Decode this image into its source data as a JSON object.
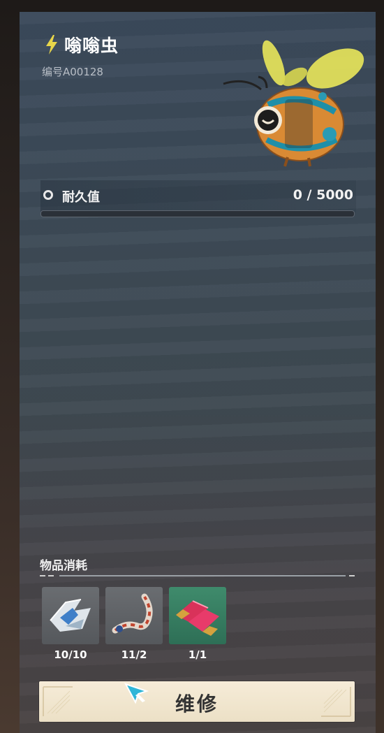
{
  "creature": {
    "name": "嗡嗡虫",
    "code": "编号A00128",
    "type_icon": "lightning-bolt-icon",
    "portrait_icon": "bee-robot-icon"
  },
  "durability": {
    "label": "耐久值",
    "value_text": "0 / 5000",
    "current": 0,
    "max": 5000,
    "fraction": 0
  },
  "consumables": {
    "title": "物品消耗",
    "items": [
      {
        "icon": "metal-shards-icon",
        "count": "10/10"
      },
      {
        "icon": "twisted-fiber-icon",
        "count": "11/2"
      },
      {
        "icon": "ruby-crystal-icon",
        "count": "1/1"
      }
    ]
  },
  "repair_button": {
    "label": "维修"
  },
  "colors": {
    "accent_yellow": "#e8d64a",
    "button_bg": "#f3e8d2",
    "item_green": "#3a7f62"
  }
}
